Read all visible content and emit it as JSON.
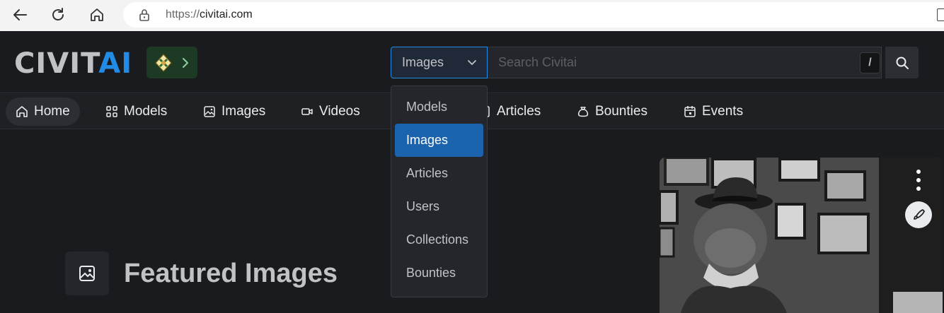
{
  "browser": {
    "url_scheme": "https://",
    "url_host": "civitai.com"
  },
  "header": {
    "logo_civ": "CIVIT",
    "logo_ai": "AI",
    "search": {
      "selected_type": "Images",
      "placeholder": "Search Civitai",
      "shortcut": "/"
    }
  },
  "nav": {
    "items": [
      {
        "label": "Home",
        "icon": "home-icon"
      },
      {
        "label": "Models",
        "icon": "grid-icon"
      },
      {
        "label": "Images",
        "icon": "image-icon"
      },
      {
        "label": "Videos",
        "icon": "video-icon"
      },
      {
        "label": "Articles",
        "icon": "article-icon"
      },
      {
        "label": "Bounties",
        "icon": "moneybag-icon"
      },
      {
        "label": "Events",
        "icon": "calendar-icon"
      }
    ]
  },
  "dropdown": {
    "options": [
      "Models",
      "Images",
      "Articles",
      "Users",
      "Collections",
      "Bounties"
    ],
    "selected": "Images"
  },
  "main": {
    "section_title": "Featured Images"
  },
  "colors": {
    "accent": "#228be6",
    "background": "#1a1b1e",
    "selected_option": "#1c63ad"
  }
}
